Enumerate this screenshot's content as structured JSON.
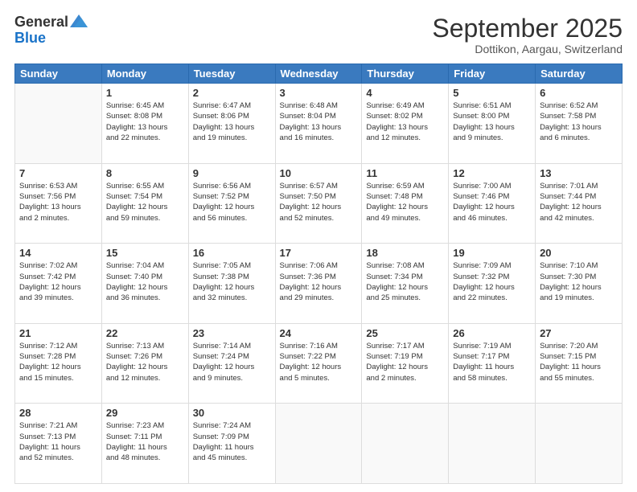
{
  "header": {
    "logo_general": "General",
    "logo_blue": "Blue",
    "month_year": "September 2025",
    "location": "Dottikon, Aargau, Switzerland"
  },
  "days_of_week": [
    "Sunday",
    "Monday",
    "Tuesday",
    "Wednesday",
    "Thursday",
    "Friday",
    "Saturday"
  ],
  "weeks": [
    [
      {
        "day": "",
        "info": ""
      },
      {
        "day": "1",
        "info": "Sunrise: 6:45 AM\nSunset: 8:08 PM\nDaylight: 13 hours\nand 22 minutes."
      },
      {
        "day": "2",
        "info": "Sunrise: 6:47 AM\nSunset: 8:06 PM\nDaylight: 13 hours\nand 19 minutes."
      },
      {
        "day": "3",
        "info": "Sunrise: 6:48 AM\nSunset: 8:04 PM\nDaylight: 13 hours\nand 16 minutes."
      },
      {
        "day": "4",
        "info": "Sunrise: 6:49 AM\nSunset: 8:02 PM\nDaylight: 13 hours\nand 12 minutes."
      },
      {
        "day": "5",
        "info": "Sunrise: 6:51 AM\nSunset: 8:00 PM\nDaylight: 13 hours\nand 9 minutes."
      },
      {
        "day": "6",
        "info": "Sunrise: 6:52 AM\nSunset: 7:58 PM\nDaylight: 13 hours\nand 6 minutes."
      }
    ],
    [
      {
        "day": "7",
        "info": "Sunrise: 6:53 AM\nSunset: 7:56 PM\nDaylight: 13 hours\nand 2 minutes."
      },
      {
        "day": "8",
        "info": "Sunrise: 6:55 AM\nSunset: 7:54 PM\nDaylight: 12 hours\nand 59 minutes."
      },
      {
        "day": "9",
        "info": "Sunrise: 6:56 AM\nSunset: 7:52 PM\nDaylight: 12 hours\nand 56 minutes."
      },
      {
        "day": "10",
        "info": "Sunrise: 6:57 AM\nSunset: 7:50 PM\nDaylight: 12 hours\nand 52 minutes."
      },
      {
        "day": "11",
        "info": "Sunrise: 6:59 AM\nSunset: 7:48 PM\nDaylight: 12 hours\nand 49 minutes."
      },
      {
        "day": "12",
        "info": "Sunrise: 7:00 AM\nSunset: 7:46 PM\nDaylight: 12 hours\nand 46 minutes."
      },
      {
        "day": "13",
        "info": "Sunrise: 7:01 AM\nSunset: 7:44 PM\nDaylight: 12 hours\nand 42 minutes."
      }
    ],
    [
      {
        "day": "14",
        "info": "Sunrise: 7:02 AM\nSunset: 7:42 PM\nDaylight: 12 hours\nand 39 minutes."
      },
      {
        "day": "15",
        "info": "Sunrise: 7:04 AM\nSunset: 7:40 PM\nDaylight: 12 hours\nand 36 minutes."
      },
      {
        "day": "16",
        "info": "Sunrise: 7:05 AM\nSunset: 7:38 PM\nDaylight: 12 hours\nand 32 minutes."
      },
      {
        "day": "17",
        "info": "Sunrise: 7:06 AM\nSunset: 7:36 PM\nDaylight: 12 hours\nand 29 minutes."
      },
      {
        "day": "18",
        "info": "Sunrise: 7:08 AM\nSunset: 7:34 PM\nDaylight: 12 hours\nand 25 minutes."
      },
      {
        "day": "19",
        "info": "Sunrise: 7:09 AM\nSunset: 7:32 PM\nDaylight: 12 hours\nand 22 minutes."
      },
      {
        "day": "20",
        "info": "Sunrise: 7:10 AM\nSunset: 7:30 PM\nDaylight: 12 hours\nand 19 minutes."
      }
    ],
    [
      {
        "day": "21",
        "info": "Sunrise: 7:12 AM\nSunset: 7:28 PM\nDaylight: 12 hours\nand 15 minutes."
      },
      {
        "day": "22",
        "info": "Sunrise: 7:13 AM\nSunset: 7:26 PM\nDaylight: 12 hours\nand 12 minutes."
      },
      {
        "day": "23",
        "info": "Sunrise: 7:14 AM\nSunset: 7:24 PM\nDaylight: 12 hours\nand 9 minutes."
      },
      {
        "day": "24",
        "info": "Sunrise: 7:16 AM\nSunset: 7:22 PM\nDaylight: 12 hours\nand 5 minutes."
      },
      {
        "day": "25",
        "info": "Sunrise: 7:17 AM\nSunset: 7:19 PM\nDaylight: 12 hours\nand 2 minutes."
      },
      {
        "day": "26",
        "info": "Sunrise: 7:19 AM\nSunset: 7:17 PM\nDaylight: 11 hours\nand 58 minutes."
      },
      {
        "day": "27",
        "info": "Sunrise: 7:20 AM\nSunset: 7:15 PM\nDaylight: 11 hours\nand 55 minutes."
      }
    ],
    [
      {
        "day": "28",
        "info": "Sunrise: 7:21 AM\nSunset: 7:13 PM\nDaylight: 11 hours\nand 52 minutes."
      },
      {
        "day": "29",
        "info": "Sunrise: 7:23 AM\nSunset: 7:11 PM\nDaylight: 11 hours\nand 48 minutes."
      },
      {
        "day": "30",
        "info": "Sunrise: 7:24 AM\nSunset: 7:09 PM\nDaylight: 11 hours\nand 45 minutes."
      },
      {
        "day": "",
        "info": ""
      },
      {
        "day": "",
        "info": ""
      },
      {
        "day": "",
        "info": ""
      },
      {
        "day": "",
        "info": ""
      }
    ]
  ]
}
